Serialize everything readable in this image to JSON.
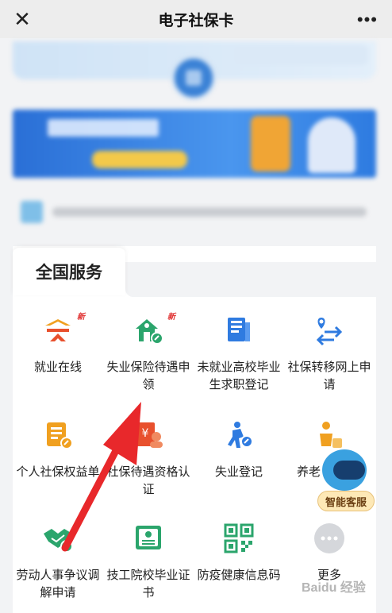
{
  "window": {
    "title": "电子社保卡",
    "close_icon": "close-icon",
    "more_icon": "more-icon"
  },
  "section": {
    "title": "全国服务"
  },
  "services": [
    {
      "label": "就业在线",
      "icon": "employment-icon",
      "badge": "新",
      "color": "#e8502d"
    },
    {
      "label": "失业保险待遇申领",
      "icon": "unemployment-insurance-icon",
      "badge": "新",
      "color": "#2ba56c"
    },
    {
      "label": "未就业高校毕业生求职登记",
      "icon": "graduate-registration-icon",
      "badge": "",
      "color": "#2f7be0"
    },
    {
      "label": "社保转移网上申请",
      "icon": "transfer-icon",
      "badge": "",
      "color": "#2f7be0"
    },
    {
      "label": "个人社保权益单",
      "icon": "rights-statement-icon",
      "badge": "",
      "color": "#f0a020"
    },
    {
      "label": "社保待遇资格认证",
      "icon": "qualification-icon",
      "badge": "",
      "color": "#e8502d"
    },
    {
      "label": "失业登记",
      "icon": "unemployment-registration-icon",
      "badge": "",
      "color": "#2f7be0"
    },
    {
      "label": "养老",
      "icon": "pension-icon",
      "badge": "",
      "color": "#f0a020"
    },
    {
      "label": "劳动人事争议调解申请",
      "icon": "dispute-mediation-icon",
      "badge": "",
      "color": "#2ba56c"
    },
    {
      "label": "技工院校毕业证书",
      "icon": "certificate-icon",
      "badge": "",
      "color": "#2ba56c"
    },
    {
      "label": "防疫健康信息码",
      "icon": "qr-code-icon",
      "badge": "",
      "color": "#2ba56c"
    },
    {
      "label": "更多",
      "icon": "more-dots-icon",
      "badge": "",
      "color": "#d5d7db"
    }
  ],
  "assistant": {
    "label": "智能客服"
  },
  "watermark": "Baidu 经验"
}
